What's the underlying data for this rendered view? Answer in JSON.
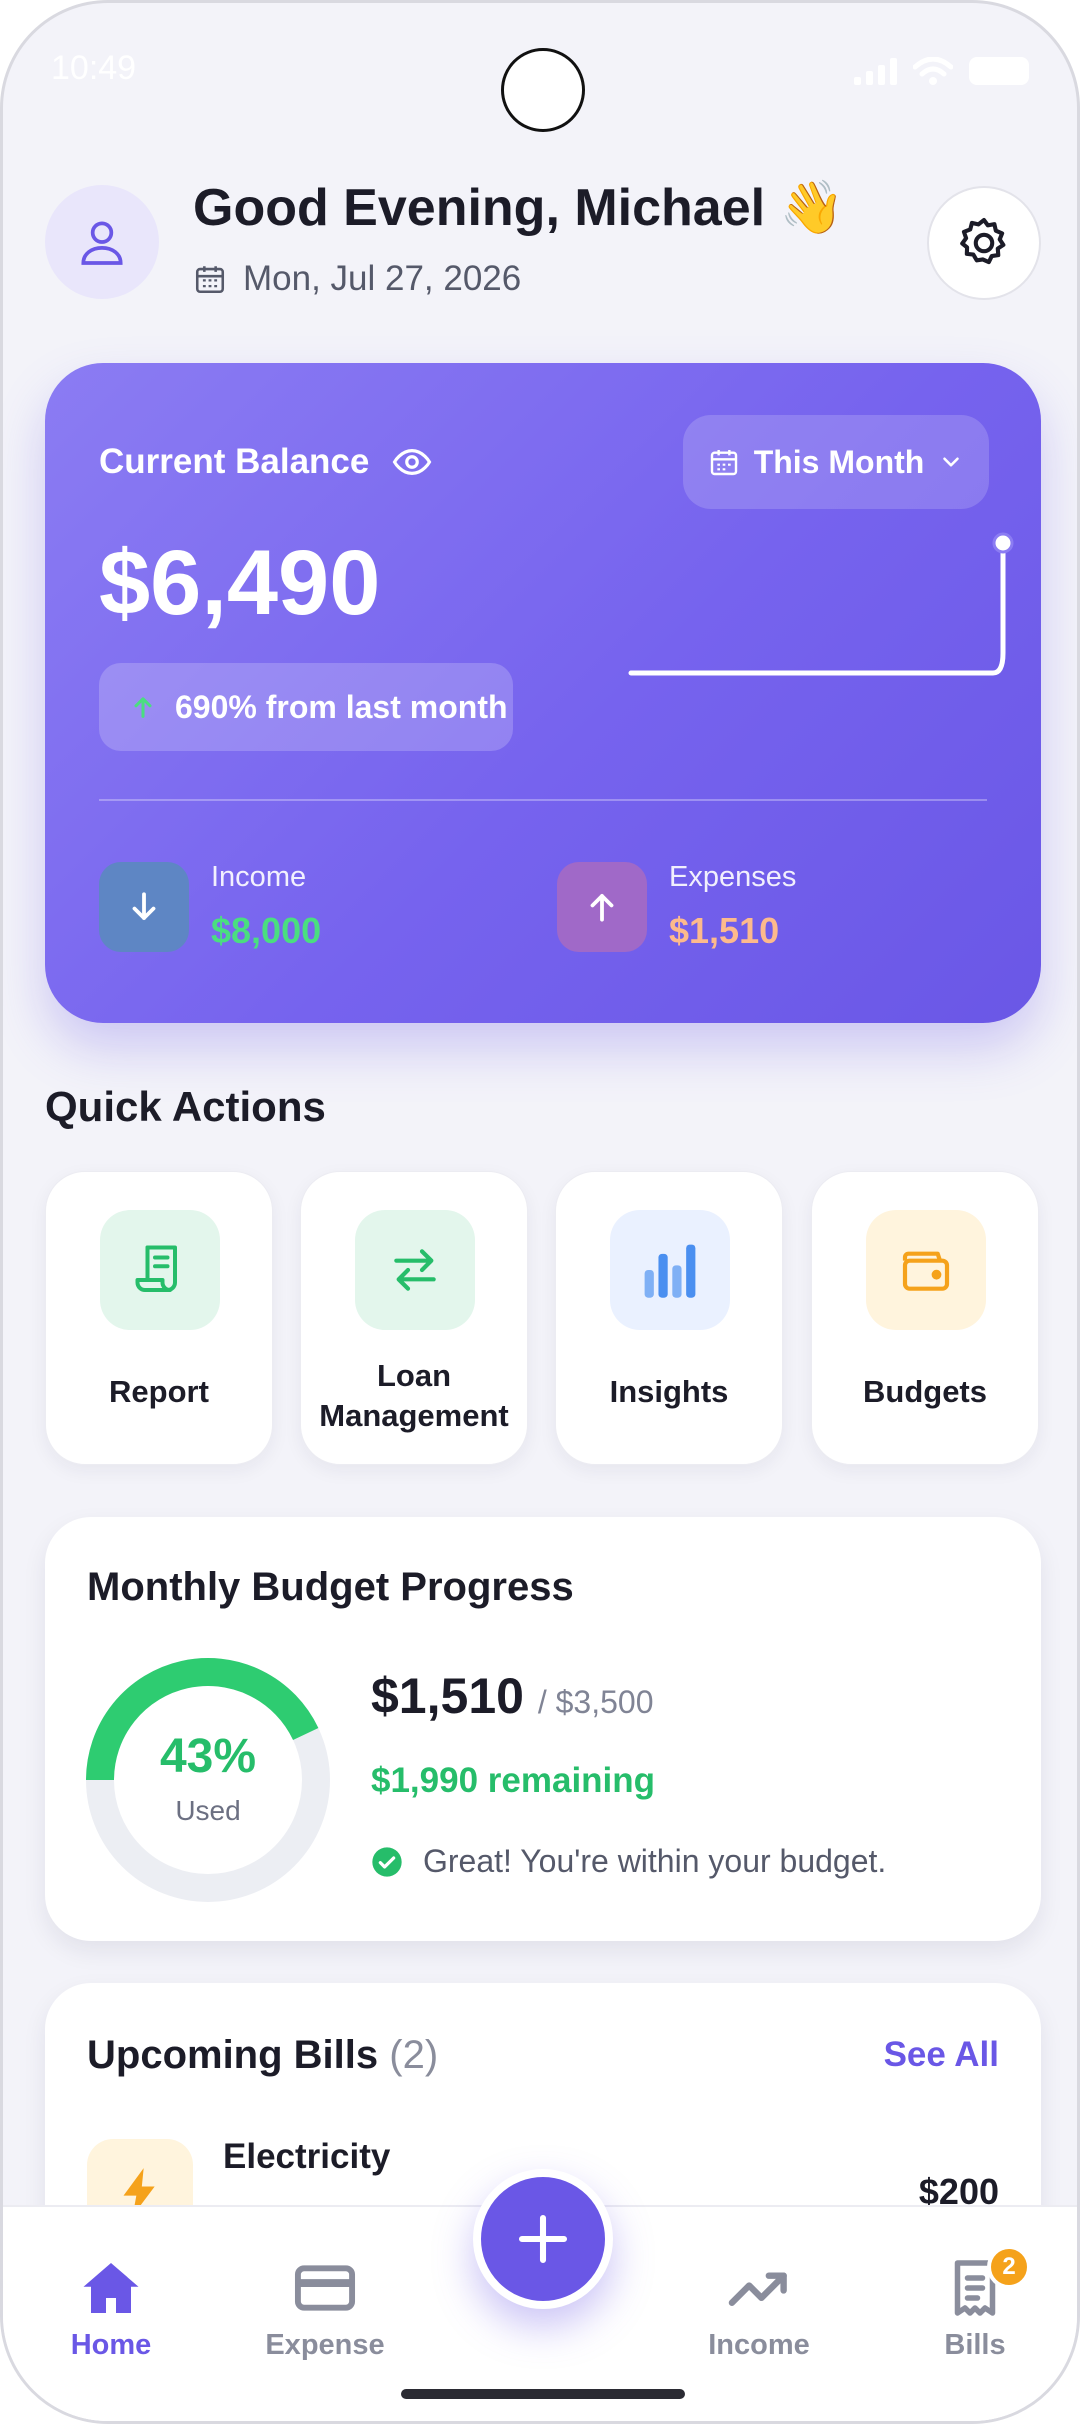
{
  "status_bar": {
    "time": "10:49"
  },
  "header": {
    "greeting": "Good Evening, Michael",
    "greeting_emoji": "👋",
    "date": "Mon, Jul 27, 2026"
  },
  "balance_card": {
    "label": "Current Balance",
    "period": "This Month",
    "amount": "$6,490",
    "change": "690% from last month",
    "sparkline": [
      0,
      0,
      0,
      0,
      0,
      0,
      0,
      0,
      0,
      0,
      0,
      6490
    ],
    "income": {
      "label": "Income",
      "value": "$8,000"
    },
    "expenses": {
      "label": "Expenses",
      "value": "$1,510"
    }
  },
  "quick_actions": {
    "title": "Quick Actions",
    "items": [
      {
        "label": "Report",
        "icon": "receipt-icon"
      },
      {
        "label": "Loan Management",
        "icon": "transfer-icon"
      },
      {
        "label": "Insights",
        "icon": "bar-chart-icon"
      },
      {
        "label": "Budgets",
        "icon": "wallet-icon"
      }
    ]
  },
  "budget": {
    "title": "Monthly Budget Progress",
    "percent": 43,
    "percent_label": "43%",
    "used_label": "Used",
    "spent": "$1,510",
    "total": "/ $3,500",
    "remaining": "$1,990 remaining",
    "status": "Great! You're within your budget."
  },
  "bills": {
    "title": "Upcoming Bills",
    "count": "(2)",
    "see_all": "See All",
    "items": [
      {
        "name": "Electricity",
        "amount": "$200",
        "icon": "lightning-icon"
      }
    ]
  },
  "nav": {
    "home": "Home",
    "expense": "Expense",
    "income": "Income",
    "bills": "Bills",
    "bills_badge": "2"
  },
  "colors": {
    "accent": "#6a57e6",
    "income": "#4ade80",
    "expense": "#fdba8c",
    "success": "#26bd6a",
    "warning": "#f5a21b"
  }
}
